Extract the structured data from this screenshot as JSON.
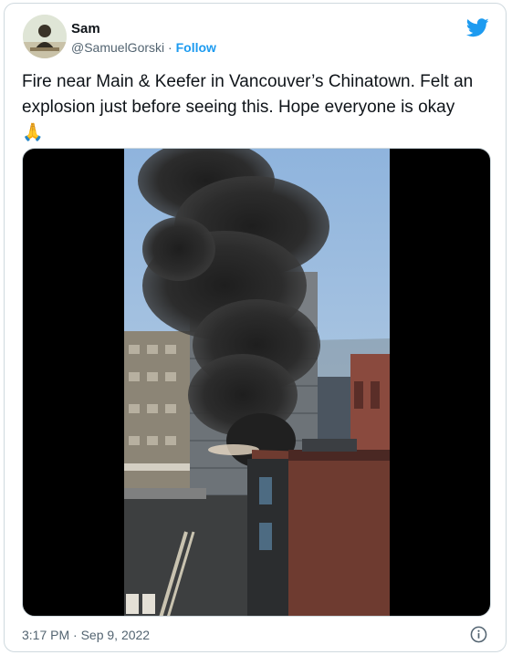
{
  "author": {
    "display_name": "Sam",
    "handle": "@SamuelGorski",
    "separator": "·",
    "follow_label": "Follow"
  },
  "tweet": {
    "text": "Fire near Main & Keefer in Vancouver’s Chinatown. Felt an explosion just before seeing this. Hope everyone is okay",
    "emoji": "🙏",
    "timestamp": "3:17 PM · Sep 9, 2022"
  },
  "icons": {
    "brand": "twitter-bird-icon",
    "info": "info-icon"
  },
  "colors": {
    "accent": "#1d9bf0",
    "text": "#0f1419",
    "muted": "#536471",
    "border": "#cfd9de"
  }
}
